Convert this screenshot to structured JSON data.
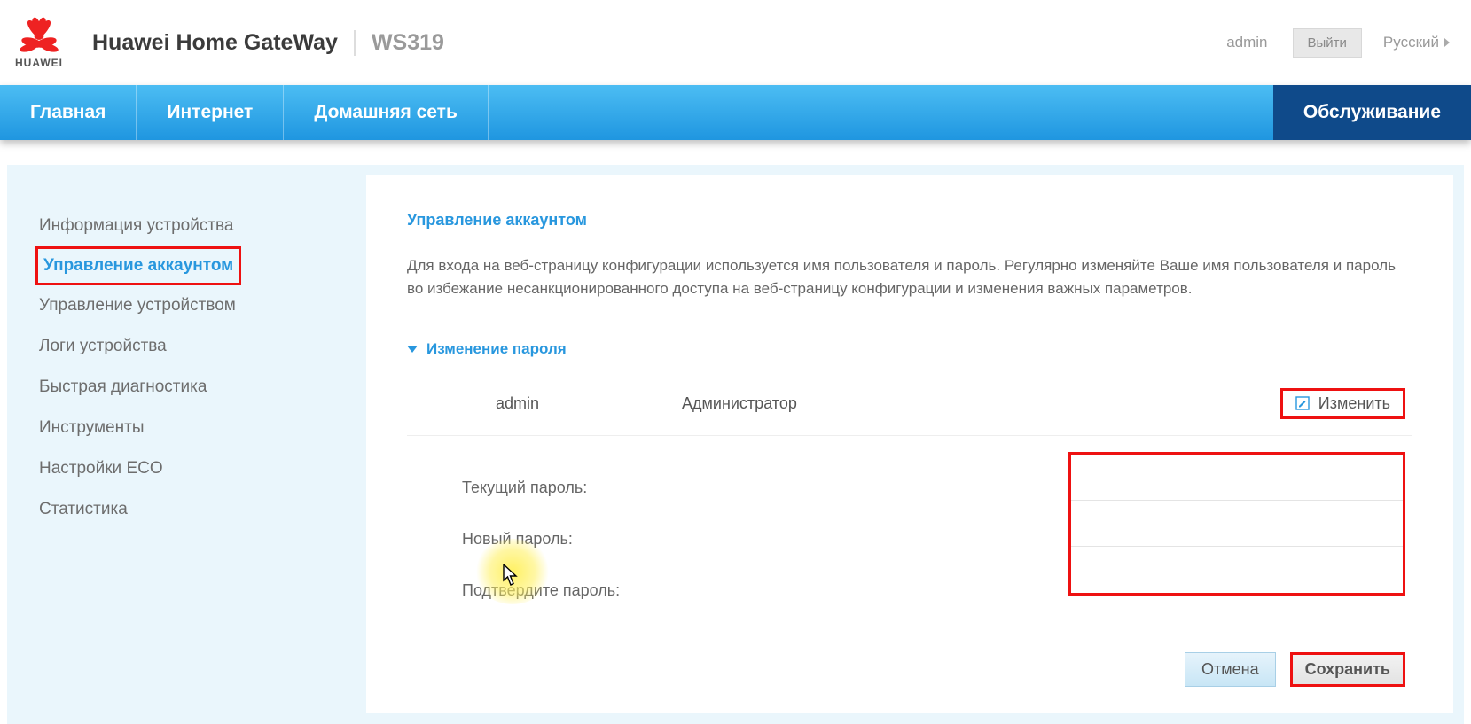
{
  "header": {
    "logo_caption": "HUAWEI",
    "brand": "Huawei Home GateWay",
    "model": "WS319",
    "user": "admin",
    "logout": "Выйти",
    "language": "Русский"
  },
  "nav": {
    "items": [
      "Главная",
      "Интернет",
      "Домашняя сеть"
    ],
    "active": "Обслуживание"
  },
  "sidebar": {
    "items": [
      "Информация устройства",
      "Управление аккаунтом",
      "Управление устройством",
      "Логи устройства",
      "Быстрая диагностика",
      "Инструменты",
      "Настройки ECO",
      "Статистика"
    ],
    "active_index": 1
  },
  "main": {
    "title": "Управление аккаунтом",
    "description": "Для входа на веб-страницу конфигурации используется имя пользователя и пароль. Регулярно изменяйте Ваше имя пользователя и пароль во избежание несанкционированного доступа на веб-страницу конфигурации и изменения важных параметров.",
    "section_header": "Изменение пароля",
    "user_row": {
      "username": "admin",
      "role": "Администратор",
      "edit_label": "Изменить"
    },
    "form": {
      "current_label": "Текущий пароль:",
      "new_label": "Новый пароль:",
      "confirm_label": "Подтвердите пароль:",
      "current_value": "",
      "new_value": "",
      "confirm_value": ""
    },
    "buttons": {
      "cancel": "Отмена",
      "save": "Сохранить"
    }
  }
}
